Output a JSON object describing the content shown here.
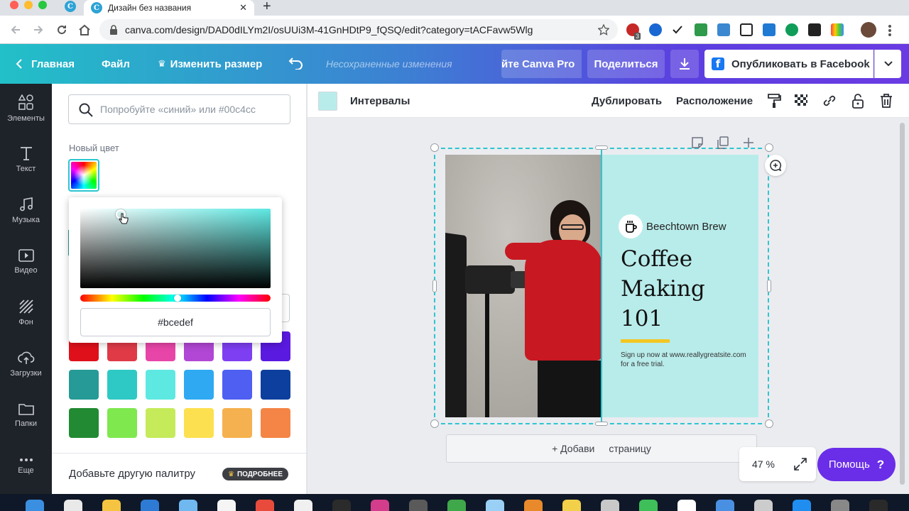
{
  "browser": {
    "active_tab_title": "Дизайн без названия",
    "url": "canva.com/design/DAD0dILYm2I/osUUi3M-41GnHDtP9_fQSQ/edit?category=tACFavw5Wlg",
    "favicon_letter": "C",
    "new_tab_symbol": "+",
    "close_tab_symbol": "✕",
    "ext_badge": "3"
  },
  "header": {
    "home_label": "Главная",
    "file_label": "Файл",
    "resize_label": "Изменить размер",
    "unsaved_label": "Несохраненные изменения",
    "canva_pro_label": "йте Canva Pro",
    "share_label": "Поделиться",
    "publish_label": "Опубликовать в Facebook"
  },
  "rail": {
    "elements": "Элементы",
    "text": "Текст",
    "music": "Музыка",
    "video": "Видео",
    "background": "Фон",
    "uploads": "Загрузки",
    "folders": "Папки",
    "more": "Еще"
  },
  "panel": {
    "search_placeholder": "Попробуйте «синий» или #00c4cc",
    "new_color_label": "Новый цвет",
    "hex_value": "#bcedef",
    "add_palette_label": "Добавьте другую палитру",
    "more_badge": "ПОДРОБНЕЕ",
    "swatches_row1": [
      "#e0101b",
      "#e03a47",
      "#e845a8",
      "#b147d4",
      "#7e3ff2",
      "#5a1ae0"
    ],
    "swatches_row2": [
      "#269a96",
      "#2ec9c4",
      "#5ee8e2",
      "#2ea9f2",
      "#4f5ff2",
      "#0d3f9e"
    ],
    "swatches_row3": [
      "#228a32",
      "#7ee84e",
      "#c5eb5a",
      "#fde04f",
      "#f5b14f",
      "#f48546"
    ],
    "picked_color": "#bcedef",
    "hue_position": 0.51
  },
  "context_bar": {
    "spacing_label": "Интервалы",
    "duplicate_label": "Дублировать",
    "arrange_label": "Расположение",
    "color_swatch": "#b8ecea"
  },
  "design": {
    "brand": "Beechtown Brew",
    "title_line1": "Coffee",
    "title_line2": "Making",
    "title_line3": "101",
    "signup_line1": "Sign up now at www.reallygreatsite.com",
    "signup_line2": "for a free trial.",
    "accent_color": "#f3c623",
    "background_color": "#b8ecea"
  },
  "editor": {
    "add_page_left": "+ Добави",
    "add_page_right": "страницу",
    "zoom_value": "47 %",
    "help_label": "Помощь",
    "help_symbol": "?"
  }
}
